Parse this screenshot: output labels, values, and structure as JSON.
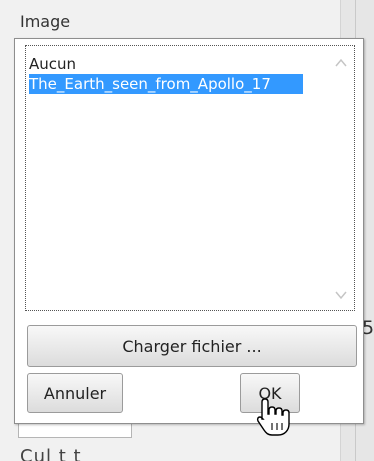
{
  "section_label": "Image",
  "listbox": {
    "items": [
      "Aucun",
      "The_Earth_seen_from_Apollo_17"
    ],
    "selected_index": 1
  },
  "buttons": {
    "upload_label": "Charger fichier ...",
    "cancel_label": "Annuler",
    "ok_label": "OK"
  },
  "background": {
    "partial_char": "5",
    "bottom_text": "Cul t t"
  },
  "colors": {
    "selection": "#3399ff",
    "selection_text": "#ffffff"
  },
  "icons": {
    "scroll_up": "chevron-up-icon",
    "scroll_down": "chevron-down-icon",
    "cursor": "hand-pointer-icon"
  }
}
